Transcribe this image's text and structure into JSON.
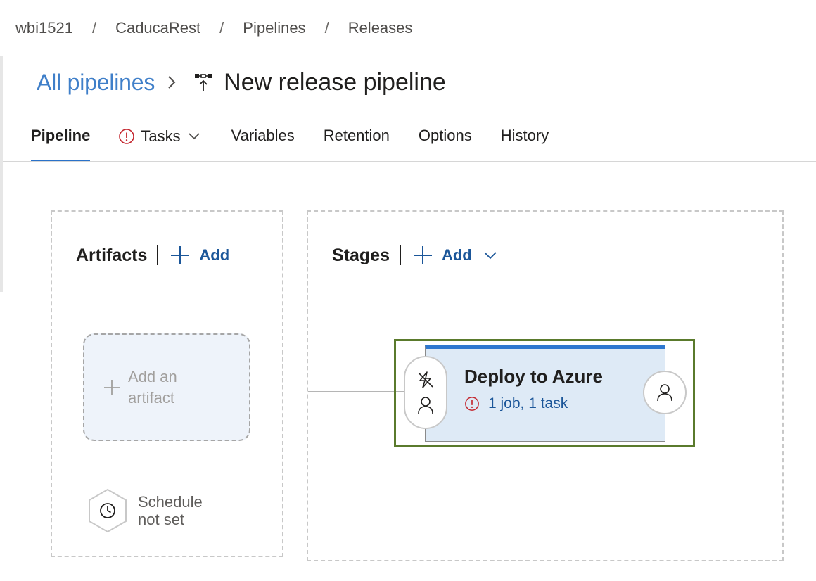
{
  "breadcrumb": {
    "items": [
      "wbi1521",
      "CaducaRest",
      "Pipelines",
      "Releases"
    ],
    "separator": "/"
  },
  "header": {
    "all_pipelines": "All pipelines",
    "title": "New release pipeline",
    "icon": "release-pipeline-icon"
  },
  "tabs": [
    {
      "label": "Pipeline",
      "active": true
    },
    {
      "label": "Tasks",
      "has_error": true,
      "has_dropdown": true
    },
    {
      "label": "Variables"
    },
    {
      "label": "Retention"
    },
    {
      "label": "Options"
    },
    {
      "label": "History"
    }
  ],
  "artifacts": {
    "title": "Artifacts",
    "add_label": "Add",
    "add_artifact_line1": "Add an",
    "add_artifact_line2": "artifact",
    "schedule_line1": "Schedule",
    "schedule_line2": "not set"
  },
  "stages": {
    "title": "Stages",
    "add_label": "Add",
    "stage": {
      "name": "Deploy to Azure",
      "status": "1 job, 1 task",
      "status_icon": "error-icon"
    }
  },
  "colors": {
    "accent": "#2a72c9",
    "link": "#1b5699",
    "error": "#c4262e",
    "stage_bg": "#deeaf6",
    "focus": "#5a7a2c"
  }
}
